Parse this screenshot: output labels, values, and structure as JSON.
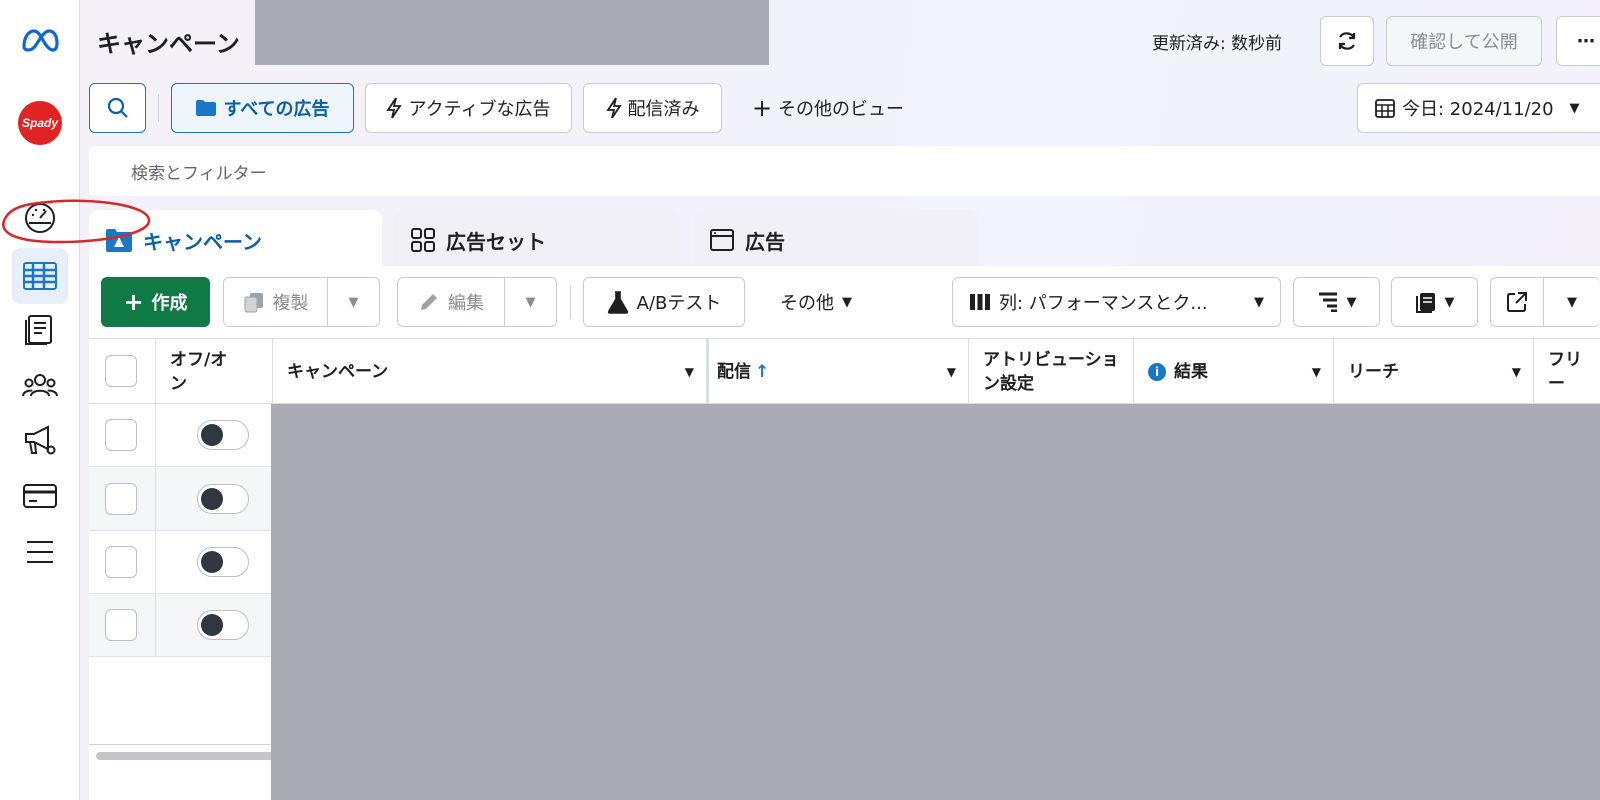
{
  "brand": {
    "logo_text": "Spady",
    "color": "#e02424"
  },
  "header": {
    "title": "キャンペーン",
    "updated": "更新済み: 数秒前",
    "publish_label": "確認して公開",
    "more_label": "⋯"
  },
  "views": {
    "all_ads": "すべての広告",
    "active_ads": "アクティブな広告",
    "delivered": "配信済み",
    "more_views": "その他のビュー",
    "date": "今日: 2024/11/20"
  },
  "search": {
    "placeholder": "検索とフィルター"
  },
  "tabs": [
    {
      "label": "キャンペーン"
    },
    {
      "label": "広告セット"
    },
    {
      "label": "広告"
    }
  ],
  "toolbar": {
    "create": "作成",
    "duplicate": "複製",
    "edit": "編集",
    "ab_test": "A/Bテスト",
    "more": "その他",
    "columns": "列: パフォーマンスとク..."
  },
  "table": {
    "headers": {
      "onoff": "オフ/オン",
      "campaign": "キャンペーン",
      "delivery": "配信",
      "attribution": "アトリビューション設定",
      "results": "結果",
      "reach": "リーチ",
      "frequency": "フリー"
    },
    "rows": [
      {
        "enabled": false
      },
      {
        "enabled": false
      },
      {
        "enabled": false
      },
      {
        "enabled": false
      }
    ]
  },
  "colors": {
    "accent": "#1877c7",
    "create_button": "#0f7a46",
    "redaction": "#a9acb3",
    "annotation": "#d62828"
  }
}
